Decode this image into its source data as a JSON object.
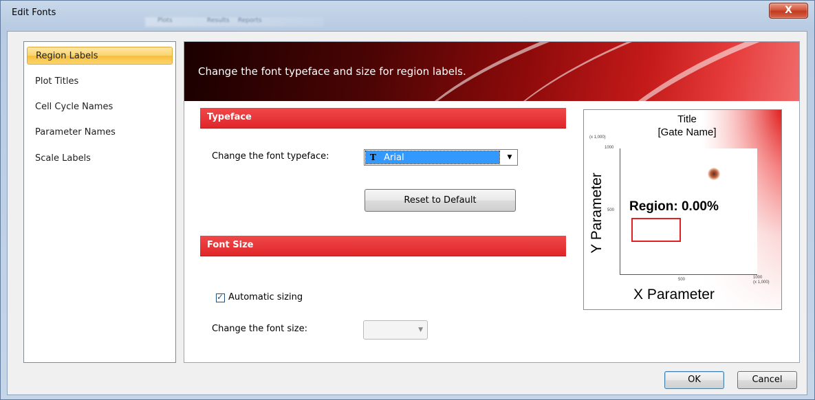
{
  "window": {
    "title": "Edit Fonts",
    "close_glyph": "X",
    "background_tabs": [
      "Plots",
      "Results",
      "Reports"
    ]
  },
  "sidebar": {
    "items": [
      {
        "label": "Region Labels",
        "selected": true
      },
      {
        "label": "Plot Titles",
        "selected": false
      },
      {
        "label": "Cell Cycle Names",
        "selected": false
      },
      {
        "label": "Parameter Names",
        "selected": false
      },
      {
        "label": "Scale Labels",
        "selected": false
      }
    ]
  },
  "banner": {
    "text": "Change the font typeface and size for region labels."
  },
  "typeface": {
    "header": "Typeface",
    "change_label": "Change the font typeface:",
    "selected_font": "Arial",
    "reset_button": "Reset to Default"
  },
  "font_size": {
    "header": "Font Size",
    "automatic_label": "Automatic sizing",
    "automatic_checked": true,
    "change_label": "Change the font size:",
    "size_value": ""
  },
  "preview": {
    "title": "Title",
    "gate_name": "[Gate Name]",
    "y_axis_label": "Y Parameter",
    "x_axis_label": "X Parameter",
    "region_label": "Region: 0.00%",
    "y_scale_unit": "(x 1,000)",
    "y_tick_top": "1000",
    "y_tick_mid": "500",
    "x_tick_mid": "500",
    "x_tick_end": "1000",
    "x_scale_unit": "(x 1,000)"
  },
  "footer": {
    "ok_label": "OK",
    "cancel_label": "Cancel"
  },
  "colors": {
    "accent_red": "#e0262a",
    "selection_blue": "#3399ff",
    "nav_selected": "#fbd36a"
  }
}
